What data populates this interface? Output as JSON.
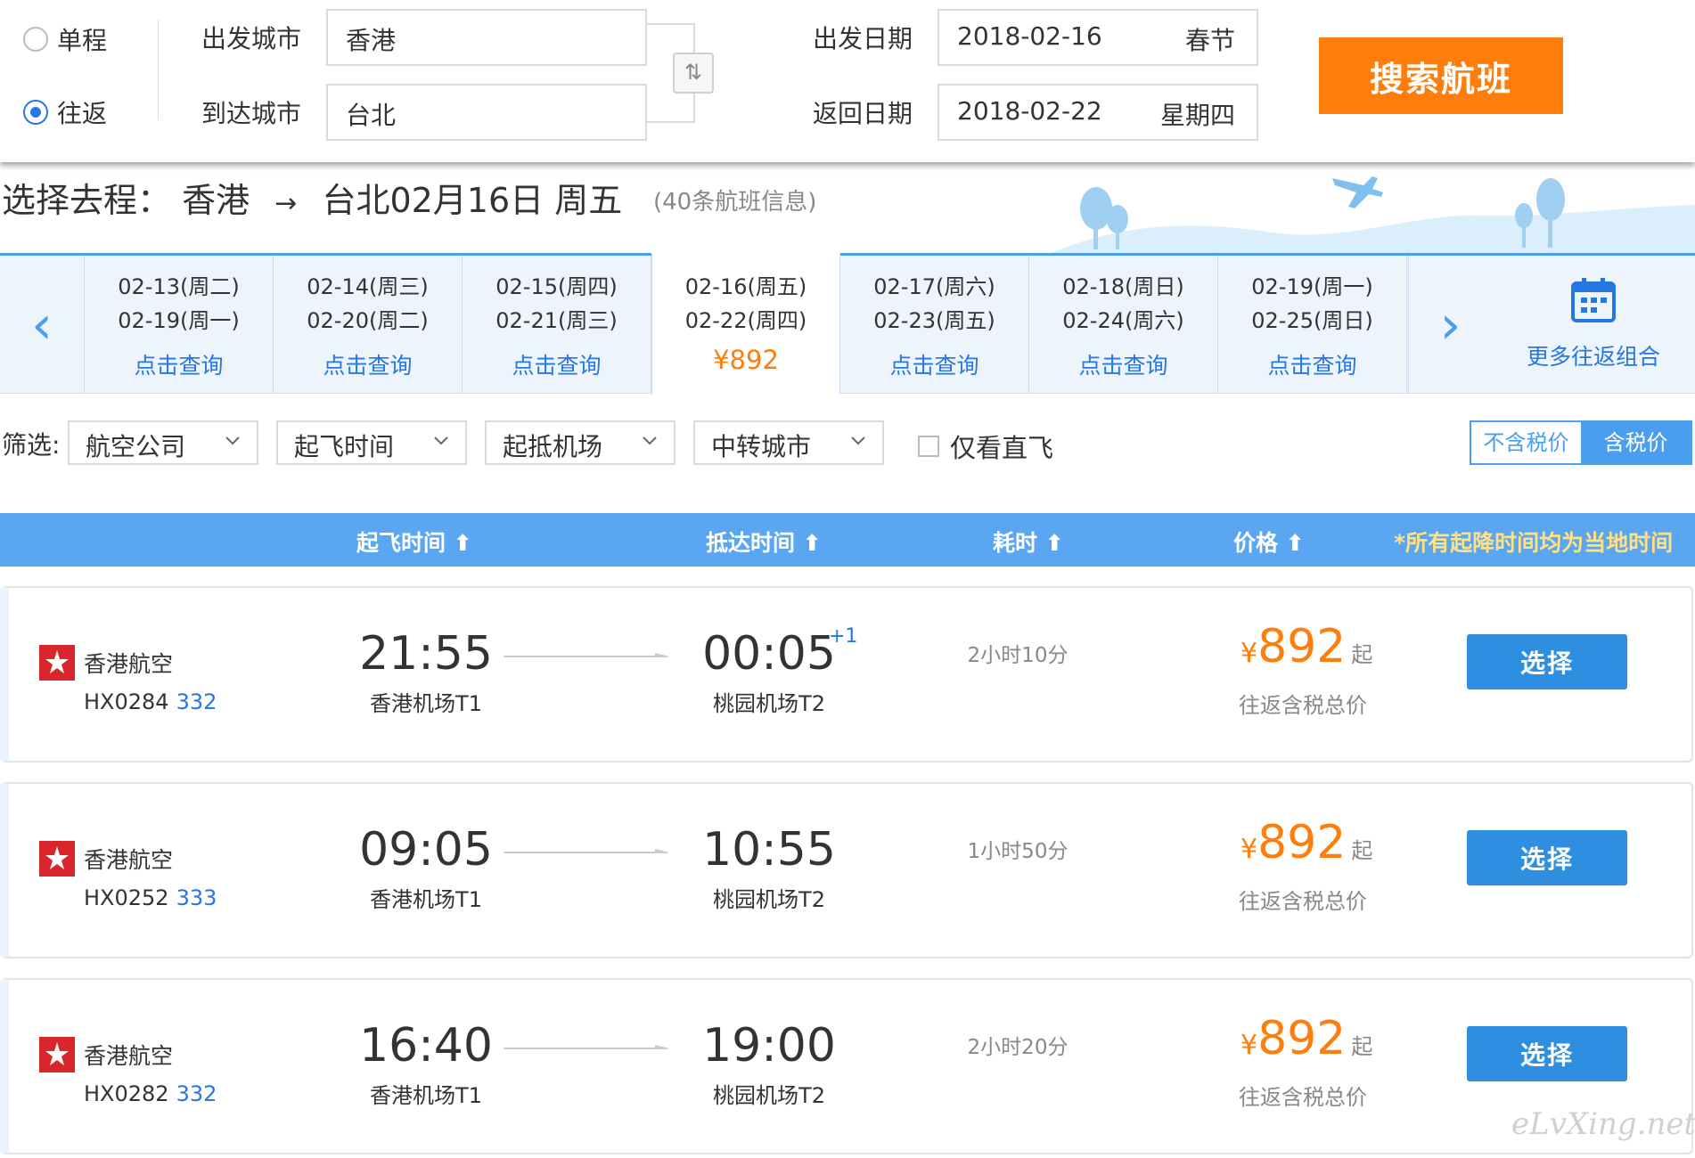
{
  "search": {
    "trip_types": [
      {
        "label": "单程",
        "selected": false
      },
      {
        "label": "往返",
        "selected": true
      }
    ],
    "depart_city_label": "出发城市",
    "depart_city": "香港",
    "arrive_city_label": "到达城市",
    "arrive_city": "台北",
    "swap_glyph": "⇅",
    "depart_date_label": "出发日期",
    "depart_date": "2018-02-16",
    "depart_date_note": "春节",
    "return_date_label": "返回日期",
    "return_date": "2018-02-22",
    "return_date_note": "星期四",
    "search_button": "搜索航班"
  },
  "route": {
    "prefix": "选择去程：",
    "from": "香港",
    "arrow": "→",
    "to_date": "台北02月16日 周五",
    "count": "(40条航班信息)"
  },
  "date_carousel": {
    "prev_glyph": "‹",
    "next_glyph": "›",
    "cells": [
      {
        "depart": "02-13(周二)",
        "return": "02-19(周一)",
        "action": "点击查询",
        "active": false
      },
      {
        "depart": "02-14(周三)",
        "return": "02-20(周二)",
        "action": "点击查询",
        "active": false
      },
      {
        "depart": "02-15(周四)",
        "return": "02-21(周三)",
        "action": "点击查询",
        "active": false
      },
      {
        "depart": "02-16(周五)",
        "return": "02-22(周四)",
        "action": "¥892",
        "active": true
      },
      {
        "depart": "02-17(周六)",
        "return": "02-23(周五)",
        "action": "点击查询",
        "active": false
      },
      {
        "depart": "02-18(周日)",
        "return": "02-24(周六)",
        "action": "点击查询",
        "active": false
      },
      {
        "depart": "02-19(周一)",
        "return": "02-25(周日)",
        "action": "点击查询",
        "active": false
      }
    ],
    "more_label": "更多往返组合",
    "more_icon": "calendar-icon"
  },
  "filters": {
    "label": "筛选:",
    "dropdowns": [
      "航空公司",
      "起飞时间",
      "起抵机场",
      "中转城市"
    ],
    "direct_only": "仅看直飞",
    "tax_excl": "不含税价",
    "tax_incl": "含税价"
  },
  "columns": {
    "depart": "起飞时间 ⬆",
    "arrive": "抵达时间 ⬆",
    "duration": "耗时 ⬆",
    "price": "价格 ⬆",
    "note": "*所有起降时间均为当地时间"
  },
  "flights": [
    {
      "airline": "香港航空",
      "flight_no": "HX0284",
      "aircraft": "332",
      "dep_time": "21:55",
      "dep_airport": "香港机场T1",
      "arr_time": "00:05",
      "arr_plus": "+1",
      "arr_airport": "桃园机场T2",
      "duration": "2小时10分",
      "currency": "¥",
      "price": "892",
      "price_suffix": "起",
      "price_note": "往返含税总价",
      "button": "选择"
    },
    {
      "airline": "香港航空",
      "flight_no": "HX0252",
      "aircraft": "333",
      "dep_time": "09:05",
      "dep_airport": "香港机场T1",
      "arr_time": "10:55",
      "arr_plus": "",
      "arr_airport": "桃园机场T2",
      "duration": "1小时50分",
      "currency": "¥",
      "price": "892",
      "price_suffix": "起",
      "price_note": "往返含税总价",
      "button": "选择"
    },
    {
      "airline": "香港航空",
      "flight_no": "HX0282",
      "aircraft": "332",
      "dep_time": "16:40",
      "dep_airport": "香港机场T1",
      "arr_time": "19:00",
      "arr_plus": "",
      "arr_airport": "桃园机场T2",
      "duration": "2小时20分",
      "currency": "¥",
      "price": "892",
      "price_suffix": "起",
      "price_note": "往返含税总价",
      "button": "选择"
    }
  ],
  "colors": {
    "accent_orange": "#ff7d0a",
    "accent_blue": "#4a9ef0",
    "link_blue": "#2577e3",
    "airline_red": "#d9262c"
  },
  "watermark": "eLvXing.net"
}
